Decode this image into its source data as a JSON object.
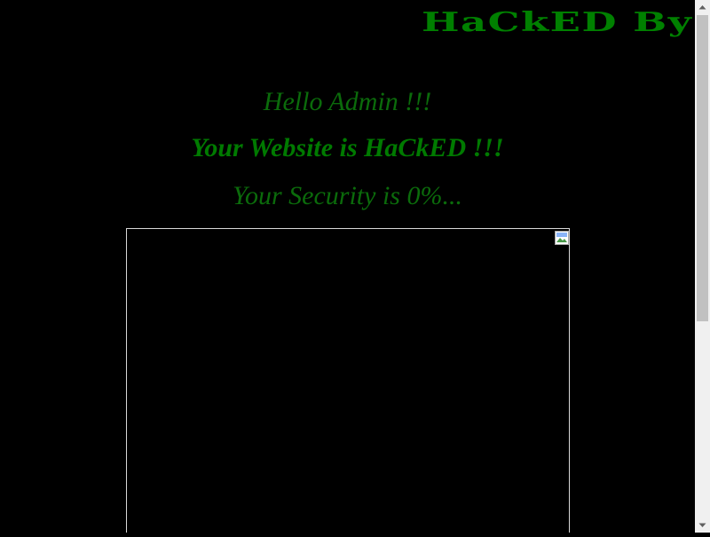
{
  "page": {
    "banner_text": "HaCkED By",
    "greeting": "Hello Admin !!!",
    "hacked_message": "Your Website is HaCkED !!!",
    "security_message": "Your Security is 0%..."
  },
  "image": {
    "icon": "broken-image-icon"
  },
  "scrollbar": {
    "up_icon": "triangle-up-icon",
    "down_icon": "triangle-down-icon",
    "thumb_position_fraction": 0.0
  },
  "colors": {
    "background": "#000000",
    "text_green": "#0b6b0b",
    "banner_green": "#008000",
    "frame_border": "#d9d9d9"
  }
}
